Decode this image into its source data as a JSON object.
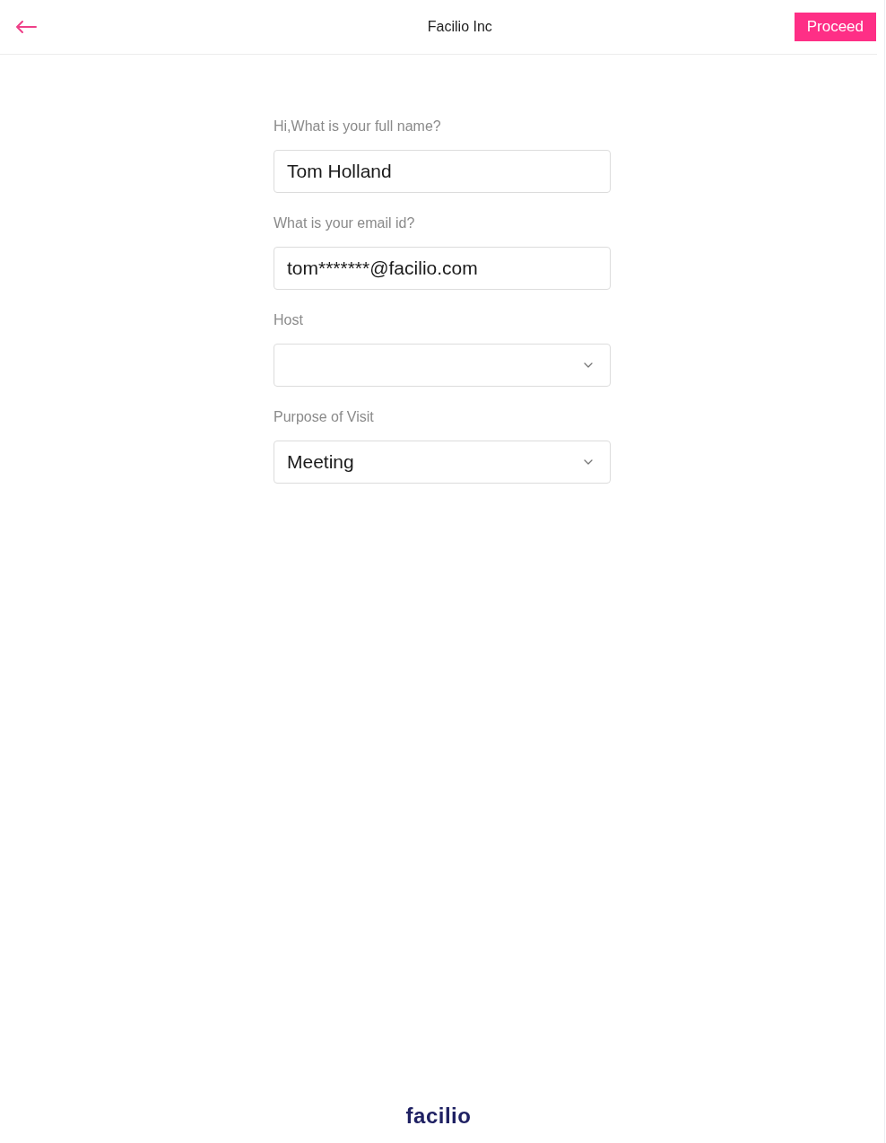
{
  "header": {
    "title": "Facilio Inc",
    "proceed_button": "Proceed"
  },
  "form": {
    "fields": [
      {
        "kind": "text",
        "label": "Hi,What is your full name?",
        "value": "Tom Holland"
      },
      {
        "kind": "text",
        "label": "What is your email id?",
        "value": "tom*******@facilio.com"
      },
      {
        "kind": "select",
        "label": "Host"
      },
      {
        "kind": "select",
        "label": "Purpose of Visit",
        "value": "Meeting"
      }
    ]
  },
  "footer": {
    "logo": "facilio"
  }
}
